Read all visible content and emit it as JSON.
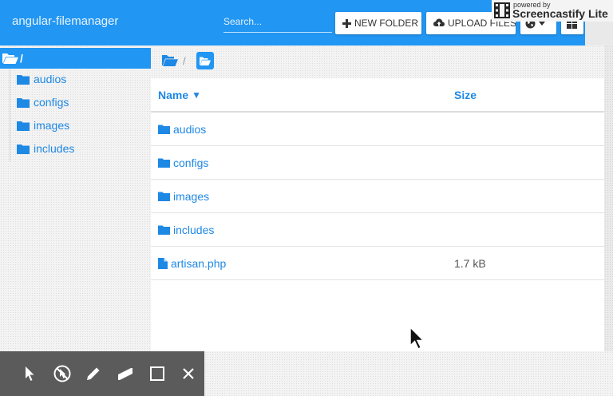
{
  "header": {
    "app_title": "angular-filemanager",
    "search_placeholder": "Search...",
    "new_folder_label": "NEW FOLDER",
    "upload_files_label": "UPLOAD FILES"
  },
  "watermark": {
    "small": "powered by",
    "big": "Screencastify Lite"
  },
  "sidebar": {
    "root_label": "/",
    "items": [
      {
        "label": "audios",
        "icon": "folder-icon"
      },
      {
        "label": "configs",
        "icon": "folder-icon"
      },
      {
        "label": "images",
        "icon": "folder-icon"
      },
      {
        "label": "includes",
        "icon": "folder-icon"
      }
    ]
  },
  "breadcrumb": {
    "separator": "/"
  },
  "table": {
    "columns": {
      "name": "Name",
      "size": "Size"
    },
    "sort_indicator": "▼",
    "rows": [
      {
        "name": "audios",
        "size": "",
        "type": "folder"
      },
      {
        "name": "configs",
        "size": "",
        "type": "folder"
      },
      {
        "name": "images",
        "size": "",
        "type": "folder"
      },
      {
        "name": "includes",
        "size": "",
        "type": "folder"
      },
      {
        "name": "artisan.php",
        "size": "1.7 kB",
        "type": "file"
      }
    ]
  },
  "annotation_tools": [
    "pointer-icon",
    "no-cursor-icon",
    "pen-icon",
    "highlighter-icon",
    "rectangle-icon",
    "close-icon"
  ],
  "colors": {
    "accent": "#2196f3",
    "link": "#1e88e5",
    "toolbar": "#5b5b5b"
  }
}
